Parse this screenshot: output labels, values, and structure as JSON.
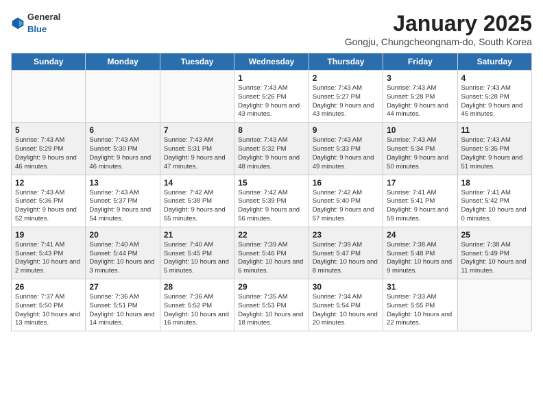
{
  "header": {
    "logo_general": "General",
    "logo_blue": "Blue",
    "title": "January 2025",
    "subtitle": "Gongju, Chungcheongnam-do, South Korea"
  },
  "weekdays": [
    "Sunday",
    "Monday",
    "Tuesday",
    "Wednesday",
    "Thursday",
    "Friday",
    "Saturday"
  ],
  "weeks": [
    [
      {
        "day": "",
        "info": ""
      },
      {
        "day": "",
        "info": ""
      },
      {
        "day": "",
        "info": ""
      },
      {
        "day": "1",
        "info": "Sunrise: 7:43 AM\nSunset: 5:26 PM\nDaylight: 9 hours and 43 minutes."
      },
      {
        "day": "2",
        "info": "Sunrise: 7:43 AM\nSunset: 5:27 PM\nDaylight: 9 hours and 43 minutes."
      },
      {
        "day": "3",
        "info": "Sunrise: 7:43 AM\nSunset: 5:28 PM\nDaylight: 9 hours and 44 minutes."
      },
      {
        "day": "4",
        "info": "Sunrise: 7:43 AM\nSunset: 5:28 PM\nDaylight: 9 hours and 45 minutes."
      }
    ],
    [
      {
        "day": "5",
        "info": "Sunrise: 7:43 AM\nSunset: 5:29 PM\nDaylight: 9 hours and 46 minutes."
      },
      {
        "day": "6",
        "info": "Sunrise: 7:43 AM\nSunset: 5:30 PM\nDaylight: 9 hours and 46 minutes."
      },
      {
        "day": "7",
        "info": "Sunrise: 7:43 AM\nSunset: 5:31 PM\nDaylight: 9 hours and 47 minutes."
      },
      {
        "day": "8",
        "info": "Sunrise: 7:43 AM\nSunset: 5:32 PM\nDaylight: 9 hours and 48 minutes."
      },
      {
        "day": "9",
        "info": "Sunrise: 7:43 AM\nSunset: 5:33 PM\nDaylight: 9 hours and 49 minutes."
      },
      {
        "day": "10",
        "info": "Sunrise: 7:43 AM\nSunset: 5:34 PM\nDaylight: 9 hours and 50 minutes."
      },
      {
        "day": "11",
        "info": "Sunrise: 7:43 AM\nSunset: 5:35 PM\nDaylight: 9 hours and 51 minutes."
      }
    ],
    [
      {
        "day": "12",
        "info": "Sunrise: 7:43 AM\nSunset: 5:36 PM\nDaylight: 9 hours and 52 minutes."
      },
      {
        "day": "13",
        "info": "Sunrise: 7:43 AM\nSunset: 5:37 PM\nDaylight: 9 hours and 54 minutes."
      },
      {
        "day": "14",
        "info": "Sunrise: 7:42 AM\nSunset: 5:38 PM\nDaylight: 9 hours and 55 minutes."
      },
      {
        "day": "15",
        "info": "Sunrise: 7:42 AM\nSunset: 5:39 PM\nDaylight: 9 hours and 56 minutes."
      },
      {
        "day": "16",
        "info": "Sunrise: 7:42 AM\nSunset: 5:40 PM\nDaylight: 9 hours and 57 minutes."
      },
      {
        "day": "17",
        "info": "Sunrise: 7:41 AM\nSunset: 5:41 PM\nDaylight: 9 hours and 59 minutes."
      },
      {
        "day": "18",
        "info": "Sunrise: 7:41 AM\nSunset: 5:42 PM\nDaylight: 10 hours and 0 minutes."
      }
    ],
    [
      {
        "day": "19",
        "info": "Sunrise: 7:41 AM\nSunset: 5:43 PM\nDaylight: 10 hours and 2 minutes."
      },
      {
        "day": "20",
        "info": "Sunrise: 7:40 AM\nSunset: 5:44 PM\nDaylight: 10 hours and 3 minutes."
      },
      {
        "day": "21",
        "info": "Sunrise: 7:40 AM\nSunset: 5:45 PM\nDaylight: 10 hours and 5 minutes."
      },
      {
        "day": "22",
        "info": "Sunrise: 7:39 AM\nSunset: 5:46 PM\nDaylight: 10 hours and 6 minutes."
      },
      {
        "day": "23",
        "info": "Sunrise: 7:39 AM\nSunset: 5:47 PM\nDaylight: 10 hours and 8 minutes."
      },
      {
        "day": "24",
        "info": "Sunrise: 7:38 AM\nSunset: 5:48 PM\nDaylight: 10 hours and 9 minutes."
      },
      {
        "day": "25",
        "info": "Sunrise: 7:38 AM\nSunset: 5:49 PM\nDaylight: 10 hours and 11 minutes."
      }
    ],
    [
      {
        "day": "26",
        "info": "Sunrise: 7:37 AM\nSunset: 5:50 PM\nDaylight: 10 hours and 13 minutes."
      },
      {
        "day": "27",
        "info": "Sunrise: 7:36 AM\nSunset: 5:51 PM\nDaylight: 10 hours and 14 minutes."
      },
      {
        "day": "28",
        "info": "Sunrise: 7:36 AM\nSunset: 5:52 PM\nDaylight: 10 hours and 16 minutes."
      },
      {
        "day": "29",
        "info": "Sunrise: 7:35 AM\nSunset: 5:53 PM\nDaylight: 10 hours and 18 minutes."
      },
      {
        "day": "30",
        "info": "Sunrise: 7:34 AM\nSunset: 5:54 PM\nDaylight: 10 hours and 20 minutes."
      },
      {
        "day": "31",
        "info": "Sunrise: 7:33 AM\nSunset: 5:55 PM\nDaylight: 10 hours and 22 minutes."
      },
      {
        "day": "",
        "info": ""
      }
    ]
  ]
}
